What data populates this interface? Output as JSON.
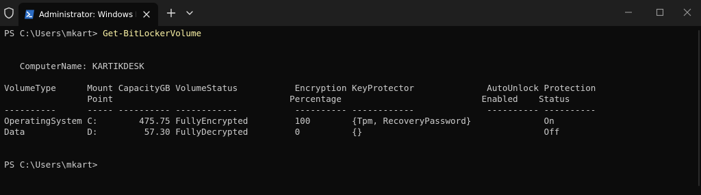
{
  "window": {
    "tab_title": "Administrator: Windows PowerShell"
  },
  "terminal": {
    "prompt": "PS C:\\Users\\mkart> ",
    "command": "Get-BitLockerVolume",
    "computer_name_line": "   ComputerName: KARTIKDESK",
    "header_line_1": "VolumeType      Mount CapacityGB VolumeStatus           Encryption KeyProtector              AutoUnlock Protection",
    "header_line_2": "                Point                                  Percentage                           Enabled    Status",
    "separator_line": "----------      ----- ---------- ------------           ---------- ------------              ---------- ----------",
    "rows": [
      "OperatingSystem C:        475.75 FullyEncrypted         100        {Tpm, RecoveryPassword}              On",
      "Data            D:         57.30 FullyDecrypted         0          {}                                   Off"
    ],
    "final_prompt": "PS C:\\Users\\mkart>"
  }
}
